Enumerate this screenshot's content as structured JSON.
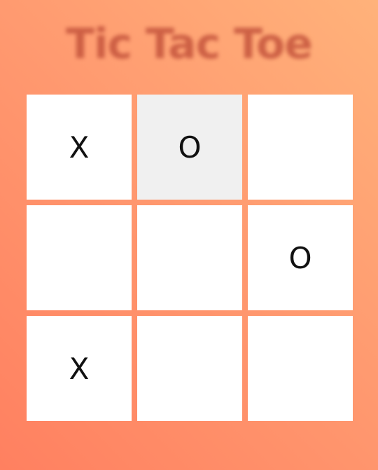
{
  "title": "Tic Tac Toe",
  "board": {
    "cells": [
      "X",
      "O",
      "",
      "",
      "",
      "O",
      "X",
      "",
      ""
    ],
    "highlighted_cell_index": 1
  },
  "colors": {
    "background_start": "#ffb27a",
    "background_end": "#ff8060",
    "title": "#c5553d",
    "cell": "#ffffff",
    "cell_highlight": "#f0f0f0",
    "mark": "#111111"
  }
}
